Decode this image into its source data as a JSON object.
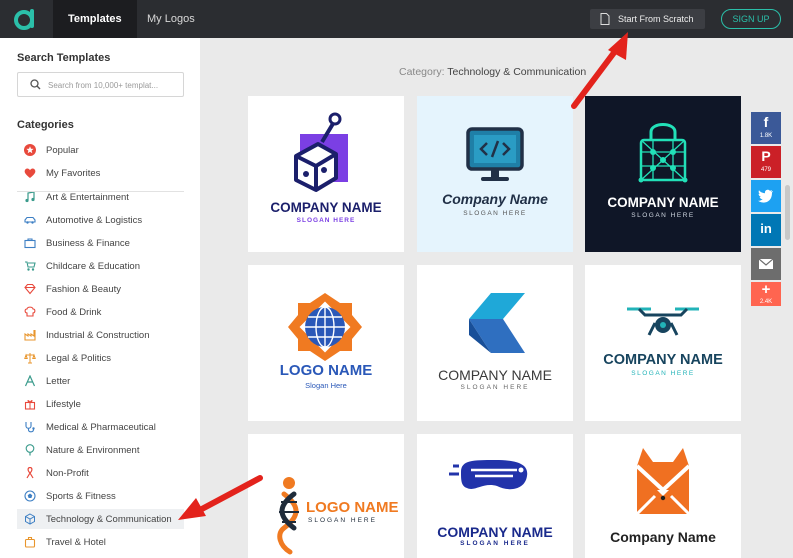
{
  "header": {
    "nav": [
      {
        "label": "Templates",
        "active": true
      },
      {
        "label": "My Logos",
        "active": false
      }
    ],
    "scratch_label": "Start From Scratch",
    "signup_label": "SIGN UP"
  },
  "sidebar": {
    "search_title": "Search Templates",
    "search_placeholder": "Search from 10,000+ templat...",
    "categories_title": "Categories",
    "pinned": [
      {
        "label": "Popular",
        "icon": "star-icon"
      },
      {
        "label": "My Favorites",
        "icon": "heart-icon"
      }
    ],
    "items": [
      {
        "label": "Art & Entertainment",
        "icon": "music-icon"
      },
      {
        "label": "Automotive & Logistics",
        "icon": "car-icon"
      },
      {
        "label": "Business & Finance",
        "icon": "briefcase-icon"
      },
      {
        "label": "Childcare & Education",
        "icon": "stroller-icon"
      },
      {
        "label": "Fashion & Beauty",
        "icon": "diamond-icon"
      },
      {
        "label": "Food & Drink",
        "icon": "chef-hat-icon"
      },
      {
        "label": "Industrial & Construction",
        "icon": "factory-icon"
      },
      {
        "label": "Legal & Politics",
        "icon": "scales-icon"
      },
      {
        "label": "Letter",
        "icon": "letter-a-icon"
      },
      {
        "label": "Lifestyle",
        "icon": "gift-icon"
      },
      {
        "label": "Medical & Pharmaceutical",
        "icon": "stethoscope-icon"
      },
      {
        "label": "Nature & Environment",
        "icon": "tree-icon"
      },
      {
        "label": "Non-Profit",
        "icon": "ribbon-icon"
      },
      {
        "label": "Sports & Fitness",
        "icon": "soccer-ball-icon"
      },
      {
        "label": "Technology & Communication",
        "icon": "cube-icon"
      },
      {
        "label": "Travel & Hotel",
        "icon": "suitcase-icon"
      }
    ],
    "active_category": "Technology & Communication"
  },
  "main": {
    "category_prefix": "Category:",
    "category_name": "Technology & Communication",
    "templates": [
      {
        "name": "COMPANY NAME",
        "slogan": "SLOGAN HERE",
        "logo": "cube-joystick-icon"
      },
      {
        "name": "Company Name",
        "slogan": "SLOGAN HERE",
        "logo": "code-monitor-icon"
      },
      {
        "name": "COMPANY NAME",
        "slogan": "SLOGAN HERE",
        "logo": "network-lock-icon"
      },
      {
        "name": "LOGO NAME",
        "slogan": "Slogan Here",
        "logo": "globe-badge-icon"
      },
      {
        "name": "COMPANY NAME",
        "slogan": "SLOGAN HERE",
        "logo": "letter-c-icon"
      },
      {
        "name": "COMPANY NAME",
        "slogan": "SLOGAN HERE",
        "logo": "drone-icon"
      },
      {
        "name": "LOGO NAME",
        "slogan": "SLOGAN HERE",
        "logo": "dna-helix-icon"
      },
      {
        "name": "COMPANY NAME",
        "slogan": "SLOGAN HERE",
        "logo": "vr-headset-icon"
      },
      {
        "name": "Company Name",
        "slogan": "",
        "logo": "fox-mail-icon"
      }
    ]
  },
  "share": [
    {
      "network": "facebook",
      "glyph": "f",
      "count": "1.8K",
      "color": "#3b5998"
    },
    {
      "network": "pinterest",
      "glyph": "P",
      "count": "479",
      "color": "#cb2027"
    },
    {
      "network": "twitter",
      "glyph": "t",
      "count": "",
      "color": "#1da1f2"
    },
    {
      "network": "linkedin",
      "glyph": "in",
      "count": "",
      "color": "#0077b5"
    },
    {
      "network": "email",
      "glyph": "",
      "count": "",
      "color": "#6d6d6d"
    },
    {
      "network": "more",
      "glyph": "+",
      "count": "2.4K",
      "color": "#ff6550"
    }
  ],
  "colors": {
    "topbar": "#2b2d31",
    "accent": "#2bbfa9",
    "annotation_arrow": "#e3231c"
  }
}
